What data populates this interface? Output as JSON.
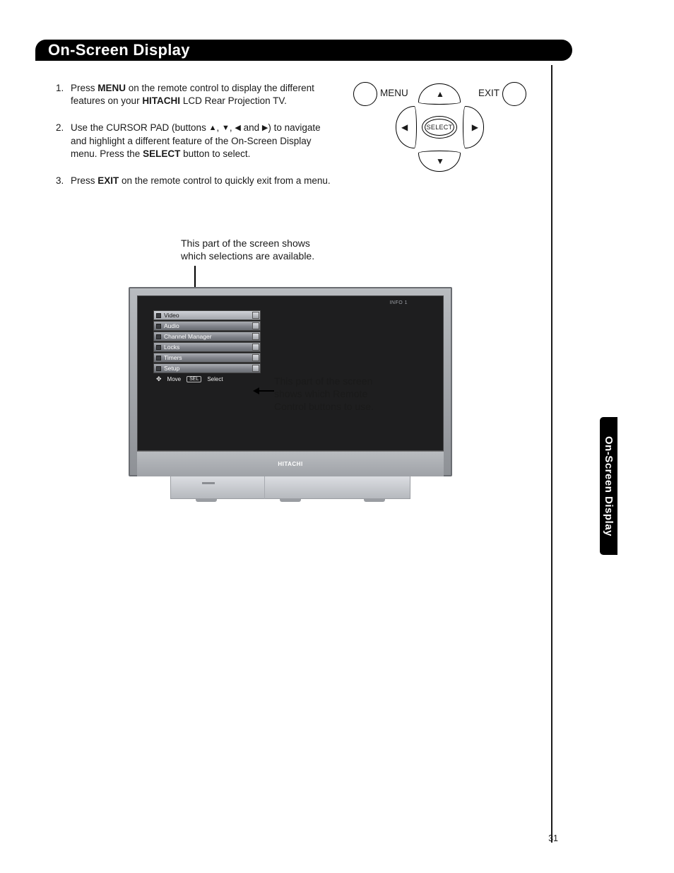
{
  "header": {
    "title": "On-Screen Display"
  },
  "instructions": {
    "item1_a": "Press ",
    "item1_menu": "MENU",
    "item1_b": " on the remote control to display the different features on your ",
    "item1_brand": "HITACHI",
    "item1_c": " LCD Rear Projection TV.",
    "item2_a": "Use the CURSOR PAD  (buttons ",
    "item2_b": ", ",
    "item2_c": ", ",
    "item2_d": " and ",
    "item2_e": ") to navigate and highlight a different feature of the On-Screen Display menu. Press the ",
    "item2_select": "SELECT",
    "item2_f": " button to select.",
    "item3_a": "Press ",
    "item3_exit": "EXIT",
    "item3_b": " on the remote control to quickly exit from a menu."
  },
  "remote": {
    "menu": "MENU",
    "exit": "EXIT",
    "select": "SELECT"
  },
  "annotations": {
    "top": "This part of the screen shows which selections are available.",
    "right": "This part of the screen shows which Remote Control buttons to use."
  },
  "osd": {
    "info1": "INFO 1",
    "items": [
      "Video",
      "Audio",
      "Channel Manager",
      "Locks",
      "Timers",
      "Setup"
    ],
    "hint_move": "Move",
    "hint_sel_tag": "SEL",
    "hint_select": "Select"
  },
  "tv": {
    "brand": "HITACHI"
  },
  "side_tab": "On-Screen Display",
  "page_number": "31"
}
